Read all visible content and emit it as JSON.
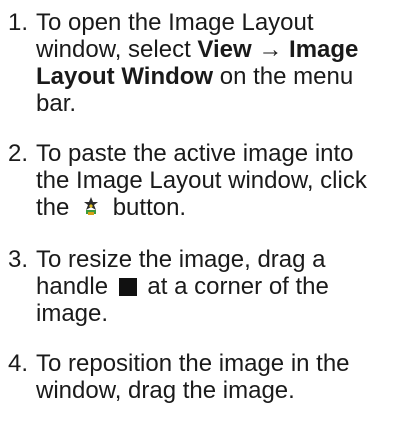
{
  "steps": [
    {
      "number": "1.",
      "text_1": "To open the Image Layout window, select ",
      "bold_1": "View",
      "arrow": "→",
      "bold_2": "Image Layout Window",
      "text_2": " on the menu bar."
    },
    {
      "number": "2.",
      "text_1": "To paste the active image into the Image Layout window, click the ",
      "icon": "paste-image-icon",
      "text_2": " button."
    },
    {
      "number": "3.",
      "text_1": "To resize the image, drag a handle ",
      "icon": "handle-square-icon",
      "text_2": " at a corner of the image."
    },
    {
      "number": "4.",
      "text_1": "To reposition the image in the window, drag the image."
    }
  ],
  "colors": {
    "text": "#1a1a1a",
    "background": "#ffffff",
    "handle": "#111111"
  }
}
